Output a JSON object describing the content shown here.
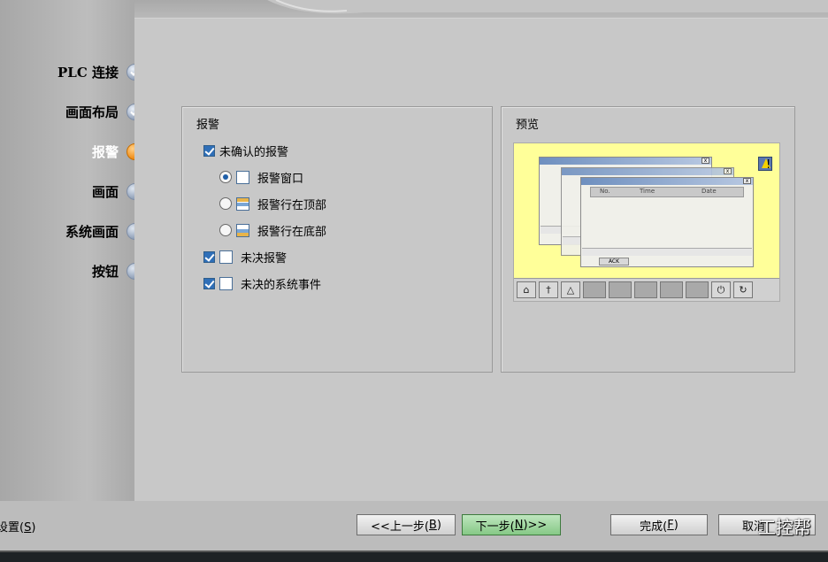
{
  "steps": [
    {
      "label": "PLC 连接",
      "state": "done"
    },
    {
      "label": "画面布局",
      "state": "done"
    },
    {
      "label": "报警",
      "state": "current"
    },
    {
      "label": "画面",
      "state": "todo"
    },
    {
      "label": "系统画面",
      "state": "todo"
    },
    {
      "label": "按钮",
      "state": "todo"
    }
  ],
  "alarms_group": {
    "title": "报警",
    "unack_alarms": {
      "label": "未确认的报警",
      "checked": true
    },
    "display": [
      {
        "label": "报警窗口",
        "selected": true,
        "icon": "alarm-window-icon"
      },
      {
        "label": "报警行在顶部",
        "selected": false,
        "icon": "alarm-line-top-icon"
      },
      {
        "label": "报警行在底部",
        "selected": false,
        "icon": "alarm-line-bottom-icon"
      }
    ],
    "pending_alarms": {
      "label": "未决报警",
      "checked": true
    },
    "pending_system_events": {
      "label": "未决的系统事件",
      "checked": true
    }
  },
  "preview_group": {
    "title": "预览",
    "table_headers": [
      "No.",
      "Time",
      "Date"
    ],
    "ack_button": "ACK"
  },
  "footer": {
    "settings_text": "设置",
    "settings_key": "S",
    "back_text": "<<上一步(",
    "back_key": "B",
    "back_end": ")",
    "next_text": "下一步(",
    "next_key": "N",
    "next_end": ")>>",
    "finish_text": "完成(",
    "finish_key": "F",
    "finish_end": ")",
    "cancel_text": "取消"
  },
  "watermark": "工控帮",
  "colors": {
    "accent_current": "#f08a12",
    "checkbox": "#2f6fb8",
    "preview_bg": "#ffff99",
    "primary_button": "#86c986"
  }
}
